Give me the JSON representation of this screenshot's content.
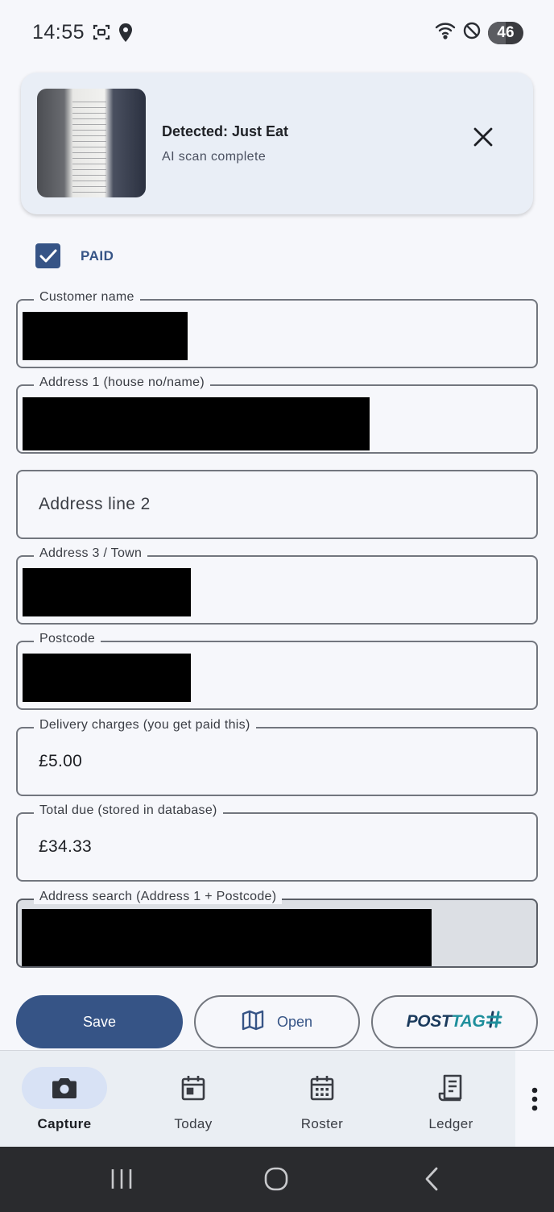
{
  "status_bar": {
    "time": "14:55",
    "battery": "46",
    "icons": [
      "screenshot-icon",
      "location-icon",
      "wifi-icon",
      "do-not-disturb-icon",
      "battery-icon"
    ]
  },
  "detection_card": {
    "title": "Detected: Just Eat",
    "subtitle": "AI scan complete",
    "close_icon": "close-icon"
  },
  "paid": {
    "label": "PAID",
    "checked": true
  },
  "fields": {
    "customer_name": {
      "label": "Customer name",
      "value": ""
    },
    "address1": {
      "label": "Address 1 (house no/name)",
      "value": ""
    },
    "address2": {
      "placeholder": "Address line 2"
    },
    "address3": {
      "label": "Address 3 / Town",
      "value": ""
    },
    "postcode": {
      "label": "Postcode",
      "value": ""
    },
    "delivery_charges": {
      "label": "Delivery charges (you get paid this)",
      "value": "£5.00"
    },
    "total_due": {
      "label": "Total due (stored in database)",
      "value": "£34.33"
    },
    "address_search": {
      "label": "Address search (Address 1 + Postcode)",
      "value": ""
    }
  },
  "actions": {
    "save": "Save",
    "open": "Open",
    "posttag_post": "POST",
    "posttag_tag": "TAG"
  },
  "bottom_nav": {
    "items": [
      {
        "label": "Capture",
        "icon": "camera-icon",
        "active": true
      },
      {
        "label": "Today",
        "icon": "calendar-today-icon",
        "active": false
      },
      {
        "label": "Roster",
        "icon": "calendar-grid-icon",
        "active": false
      },
      {
        "label": "Ledger",
        "icon": "receipt-icon",
        "active": false
      }
    ]
  },
  "colors": {
    "primary": "#365486",
    "background": "#f6f7fb",
    "card": "#e9eef6",
    "outline": "#72767e",
    "accent_teal": "#1f8f9c"
  }
}
